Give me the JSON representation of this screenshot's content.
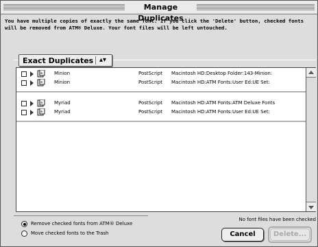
{
  "window": {
    "title": "Manage Duplicates"
  },
  "message": "You have multiple copies of exactly the same font. If you click the 'Delete' button, checked fonts will be removed from ATM® Deluxe. Your font files will be left untouched.",
  "popup": {
    "selected": "Exact Duplicates",
    "arrows": "▴▾"
  },
  "list": {
    "rows": [
      {
        "name": "Minion",
        "kind": "PostScript",
        "path": "Macintosh HD:Desktop Folder:143-Minion:",
        "checked": false
      },
      {
        "name": "Minion",
        "kind": "PostScript",
        "path": "Macintosh HD:ATM Fonts:User Ed:UE Set:",
        "checked": false
      },
      {
        "name": "Myriad",
        "kind": "PostScript",
        "path": "Macintosh HD:ATM Fonts:ATM Deluxe Fonts",
        "checked": false
      },
      {
        "name": "Myriad",
        "kind": "PostScript",
        "path": "Macintosh HD:ATM Fonts:User Ed:UE Set:",
        "checked": false
      }
    ]
  },
  "options": {
    "remove_label": "Remove checked fonts from ATM® Deluxe",
    "trash_label": "Move checked fonts to the Trash",
    "selected": "remove"
  },
  "status": "No font files have been checked",
  "buttons": {
    "cancel": "Cancel",
    "delete": "Delete..."
  },
  "colors": {
    "window_bg": "#dddddd",
    "list_bg": "#ffffff",
    "disabled_text": "#aaaaaa"
  }
}
